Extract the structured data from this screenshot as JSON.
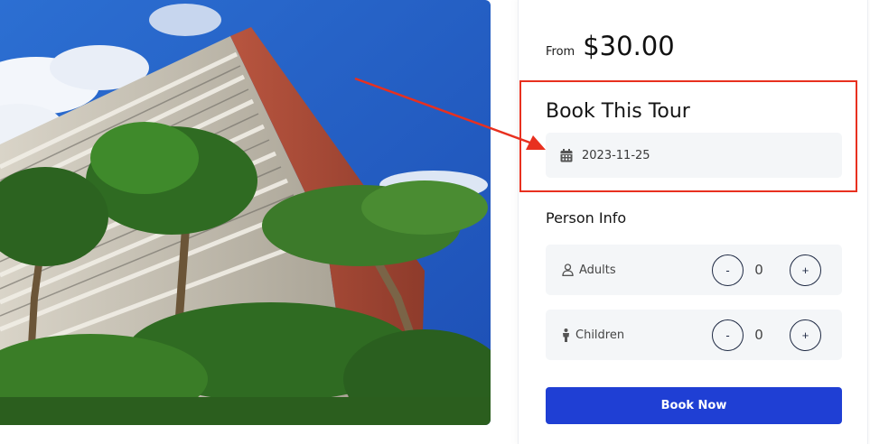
{
  "booking": {
    "price_prefix": "From",
    "price_value": "$30.00",
    "title": "Book This Tour",
    "date_value": "2023-11-25",
    "person_info_title": "Person Info",
    "adults": {
      "label": "Adults",
      "value": "0",
      "minus": "-",
      "plus": "+"
    },
    "children": {
      "label": "Children",
      "value": "0",
      "minus": "-",
      "plus": "+"
    },
    "book_button": "Book Now"
  },
  "icons": {
    "date": "calendar-icon",
    "adults": "user-icon",
    "children": "child-icon"
  },
  "colors": {
    "primary_button": "#1f3fd4",
    "annotation": "#e8301f",
    "field_background": "#f4f6f8"
  }
}
